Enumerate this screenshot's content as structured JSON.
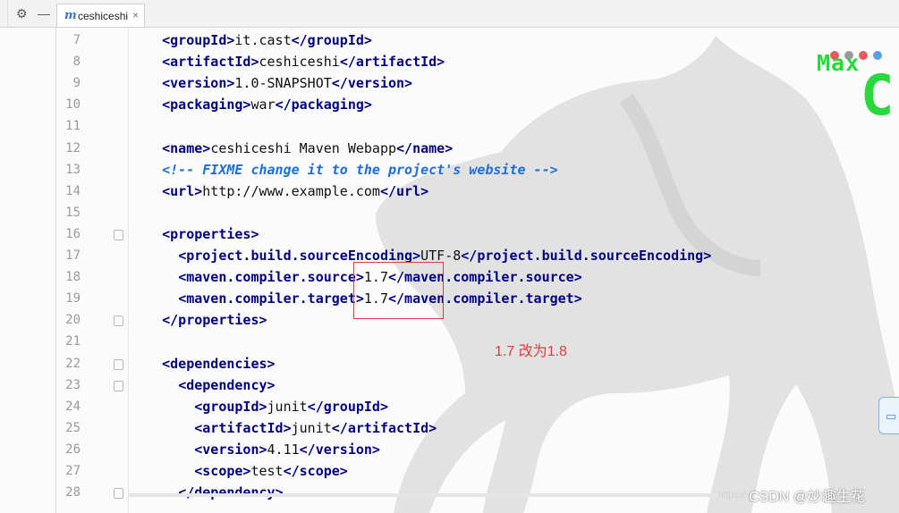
{
  "toolbar": {
    "gear_icon": "gear-icon",
    "minimize_icon": "minus-icon"
  },
  "tab": {
    "icon_letter": "m",
    "label": "ceshiceshi",
    "close": "×"
  },
  "editor": {
    "lines": [
      {
        "n": "7",
        "fold": "none",
        "indent": "    ",
        "parts": [
          [
            "t",
            "<groupId>"
          ],
          [
            "x",
            "it.cast"
          ],
          [
            "t",
            "</groupId>"
          ]
        ]
      },
      {
        "n": "8",
        "fold": "none",
        "indent": "    ",
        "parts": [
          [
            "t",
            "<artifactId>"
          ],
          [
            "x",
            "ceshiceshi"
          ],
          [
            "t",
            "</artifactId>"
          ]
        ]
      },
      {
        "n": "9",
        "fold": "none",
        "indent": "    ",
        "parts": [
          [
            "t",
            "<version>"
          ],
          [
            "x",
            "1.0-SNAPSHOT"
          ],
          [
            "t",
            "</version>"
          ]
        ]
      },
      {
        "n": "10",
        "fold": "none",
        "indent": "    ",
        "parts": [
          [
            "t",
            "<packaging>"
          ],
          [
            "x",
            "war"
          ],
          [
            "t",
            "</packaging>"
          ]
        ]
      },
      {
        "n": "11",
        "fold": "none",
        "indent": "",
        "parts": []
      },
      {
        "n": "12",
        "fold": "none",
        "indent": "    ",
        "parts": [
          [
            "t",
            "<name>"
          ],
          [
            "x",
            "ceshiceshi Maven Webapp"
          ],
          [
            "t",
            "</name>"
          ]
        ]
      },
      {
        "n": "13",
        "fold": "none",
        "indent": "    ",
        "parts": [
          [
            "c",
            "<!-- FIXME change it to the project's website -->"
          ]
        ]
      },
      {
        "n": "14",
        "fold": "none",
        "indent": "    ",
        "parts": [
          [
            "t",
            "<url>"
          ],
          [
            "x",
            "http://www.example.com"
          ],
          [
            "t",
            "</url>"
          ]
        ]
      },
      {
        "n": "15",
        "fold": "none",
        "indent": "",
        "parts": []
      },
      {
        "n": "16",
        "fold": "open",
        "indent": "    ",
        "parts": [
          [
            "t",
            "<properties>"
          ]
        ]
      },
      {
        "n": "17",
        "fold": "none",
        "indent": "      ",
        "parts": [
          [
            "t",
            "<project.build.sourceEncoding>"
          ],
          [
            "x",
            "UTF-8"
          ],
          [
            "t",
            "</project.build.sourceEncoding>"
          ]
        ]
      },
      {
        "n": "18",
        "fold": "none",
        "indent": "      ",
        "parts": [
          [
            "t",
            "<maven.compiler.source>"
          ],
          [
            "x",
            "1.7"
          ],
          [
            "t",
            "</maven.compiler.source>"
          ]
        ]
      },
      {
        "n": "19",
        "fold": "none",
        "indent": "      ",
        "parts": [
          [
            "t",
            "<maven.compiler.target>"
          ],
          [
            "x",
            "1.7"
          ],
          [
            "t",
            "</maven.compiler.target>"
          ]
        ]
      },
      {
        "n": "20",
        "fold": "close",
        "indent": "    ",
        "parts": [
          [
            "t",
            "</properties>"
          ]
        ]
      },
      {
        "n": "21",
        "fold": "none",
        "indent": "",
        "parts": []
      },
      {
        "n": "22",
        "fold": "open",
        "indent": "    ",
        "parts": [
          [
            "t",
            "<dependencies>"
          ]
        ]
      },
      {
        "n": "23",
        "fold": "open",
        "indent": "      ",
        "parts": [
          [
            "t",
            "<dependency>"
          ]
        ]
      },
      {
        "n": "24",
        "fold": "none",
        "indent": "        ",
        "parts": [
          [
            "t",
            "<groupId>"
          ],
          [
            "x",
            "junit"
          ],
          [
            "t",
            "</groupId>"
          ]
        ]
      },
      {
        "n": "25",
        "fold": "none",
        "indent": "        ",
        "parts": [
          [
            "t",
            "<artifactId>"
          ],
          [
            "x",
            "junit"
          ],
          [
            "t",
            "</artifactId>"
          ]
        ]
      },
      {
        "n": "26",
        "fold": "none",
        "indent": "        ",
        "parts": [
          [
            "t",
            "<version>"
          ],
          [
            "x",
            "4.11"
          ],
          [
            "t",
            "</version>"
          ]
        ]
      },
      {
        "n": "27",
        "fold": "none",
        "indent": "        ",
        "parts": [
          [
            "t",
            "<scope>"
          ],
          [
            "x",
            "test"
          ],
          [
            "t",
            "</scope>"
          ]
        ]
      },
      {
        "n": "28",
        "fold": "close",
        "indent": "      ",
        "parts": [
          [
            "t",
            "</dependency>"
          ]
        ]
      }
    ]
  },
  "annotation": {
    "note": "1.7 改为1.8",
    "color": "#e23b3b"
  },
  "overlay": {
    "max_text": "Max",
    "big_letter": "C",
    "accent": "#27d93a"
  },
  "watermark": {
    "small": "https://",
    "main": "CSDN @妙趣生花"
  }
}
